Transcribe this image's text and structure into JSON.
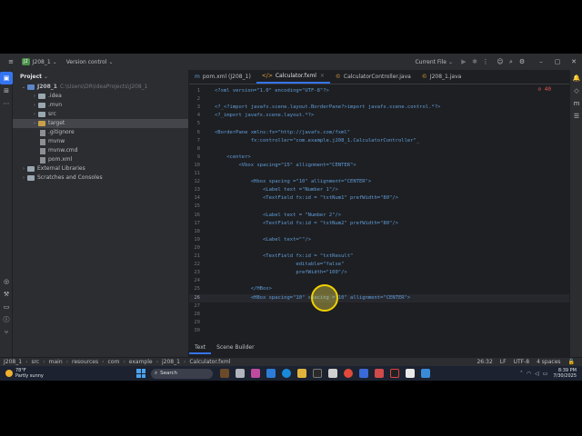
{
  "titlebar": {
    "project_badge": "J2",
    "project_name": "J208_1",
    "vcs_label": "Version control",
    "run_config": "Current File"
  },
  "project_panel": {
    "title": "Project",
    "tree": [
      {
        "label": "J208_1",
        "hint": "C:\\Users\\DR\\IdeaProjects\\J208_1",
        "depth": 0,
        "expanded": true,
        "kind": "module"
      },
      {
        "label": ".idea",
        "hint": "",
        "depth": 1,
        "expanded": false,
        "kind": "folder"
      },
      {
        "label": ".mvn",
        "hint": "",
        "depth": 1,
        "expanded": false,
        "kind": "folder"
      },
      {
        "label": "src",
        "hint": "",
        "depth": 1,
        "expanded": false,
        "kind": "folder"
      },
      {
        "label": "target",
        "hint": "",
        "depth": 1,
        "expanded": false,
        "kind": "folder-orange"
      },
      {
        "label": ".gitignore",
        "hint": "",
        "depth": 1,
        "expanded": null,
        "kind": "file"
      },
      {
        "label": "mvnw",
        "hint": "",
        "depth": 1,
        "expanded": null,
        "kind": "file"
      },
      {
        "label": "mvnw.cmd",
        "hint": "",
        "depth": 1,
        "expanded": null,
        "kind": "file"
      },
      {
        "label": "pom.xml",
        "hint": "",
        "depth": 1,
        "expanded": null,
        "kind": "file"
      },
      {
        "label": "External Libraries",
        "hint": "",
        "depth": 0,
        "expanded": false,
        "kind": "lib"
      },
      {
        "label": "Scratches and Consoles",
        "hint": "",
        "depth": 0,
        "expanded": false,
        "kind": "scratch"
      }
    ]
  },
  "editor": {
    "tabs": [
      {
        "label": "pom.xml (J208_1)",
        "icon": "m",
        "active": false
      },
      {
        "label": "Calculator.fxml",
        "icon": "</>",
        "active": true
      },
      {
        "label": "CalculatorController.java",
        "icon": "©",
        "active": false
      },
      {
        "label": "J208_1.java",
        "icon": "©",
        "active": false
      }
    ],
    "problems": "⊘ 40",
    "lines": [
      {
        "n": "1",
        "text": "<?xml version=\"1.0\" encoding=\"UTF-8\"?>"
      },
      {
        "n": "2",
        "text": ""
      },
      {
        "n": "3",
        "text": "<?_<?import javafx.scene.layout.BorderPane?>import javafx.scene.control.*?>"
      },
      {
        "n": "4",
        "text": "<?_import javafx.scene.layout.*?>"
      },
      {
        "n": "5",
        "text": ""
      },
      {
        "n": "6",
        "text": "<BorderPane xmlns:fx=\"http://javafx.com/fxml\""
      },
      {
        "n": "7",
        "text": "            fx:controller=\"com.example.j208_1.CalculatorController\"_"
      },
      {
        "n": "8",
        "text": ""
      },
      {
        "n": "9",
        "text": "    <center>"
      },
      {
        "n": "10",
        "text": "        <Vbox spacing=\"15\" allignment=\"CENTER\">"
      },
      {
        "n": "11",
        "text": ""
      },
      {
        "n": "12",
        "text": "            <Hbox spacing =\"10\" allignment=\"CENTER\">"
      },
      {
        "n": "13",
        "text": "                <Label text =\"Number 1\"/>"
      },
      {
        "n": "14",
        "text": "                <TextField fx:id = \"txtNum1\" prefWidth=\"80\"/>"
      },
      {
        "n": "15",
        "text": ""
      },
      {
        "n": "16",
        "text": "                <Label text = \"Number 2\"/>"
      },
      {
        "n": "17",
        "text": "                <TextField fx:id = \"txtNum2\" prefWidth=\"80\"/>"
      },
      {
        "n": "18",
        "text": ""
      },
      {
        "n": "19",
        "text": "                <Label text=\"\"/>"
      },
      {
        "n": "20",
        "text": ""
      },
      {
        "n": "21",
        "text": "                <TextField fx:id = \"txtResult\""
      },
      {
        "n": "22",
        "text": "                           editable=\"false\""
      },
      {
        "n": "23",
        "text": "                           prefWidth=\"100\"/>"
      },
      {
        "n": "24",
        "text": ""
      },
      {
        "n": "25",
        "text": "            </HBox>"
      },
      {
        "n": "26",
        "text": "            <HBox spacing=\"10\" spacing =\"10\" allignment=\"CENTER\">"
      },
      {
        "n": "27",
        "text": ""
      },
      {
        "n": "28",
        "text": ""
      },
      {
        "n": "29",
        "text": ""
      },
      {
        "n": "30",
        "text": ""
      }
    ],
    "bottom_tabs": [
      "Text",
      "Scene Builder"
    ]
  },
  "statusbar": {
    "breadcrumbs": [
      "J208_1",
      "src",
      "main",
      "resources",
      "com",
      "example",
      "j208_1",
      "Calculator.fxml"
    ],
    "position": "26:32",
    "line_sep": "LF",
    "encoding": "UTF-8",
    "indent": "4 spaces"
  },
  "taskbar": {
    "temperature": "78°F",
    "weather": "Partly sunny",
    "search_placeholder": "Search",
    "time": "8:39 PM",
    "date": "7/30/2025"
  },
  "colors": {
    "accent": "#3574f0",
    "code_blue": "#5f9cd8",
    "background": "#1e1f22",
    "panel": "#2b2d30"
  }
}
